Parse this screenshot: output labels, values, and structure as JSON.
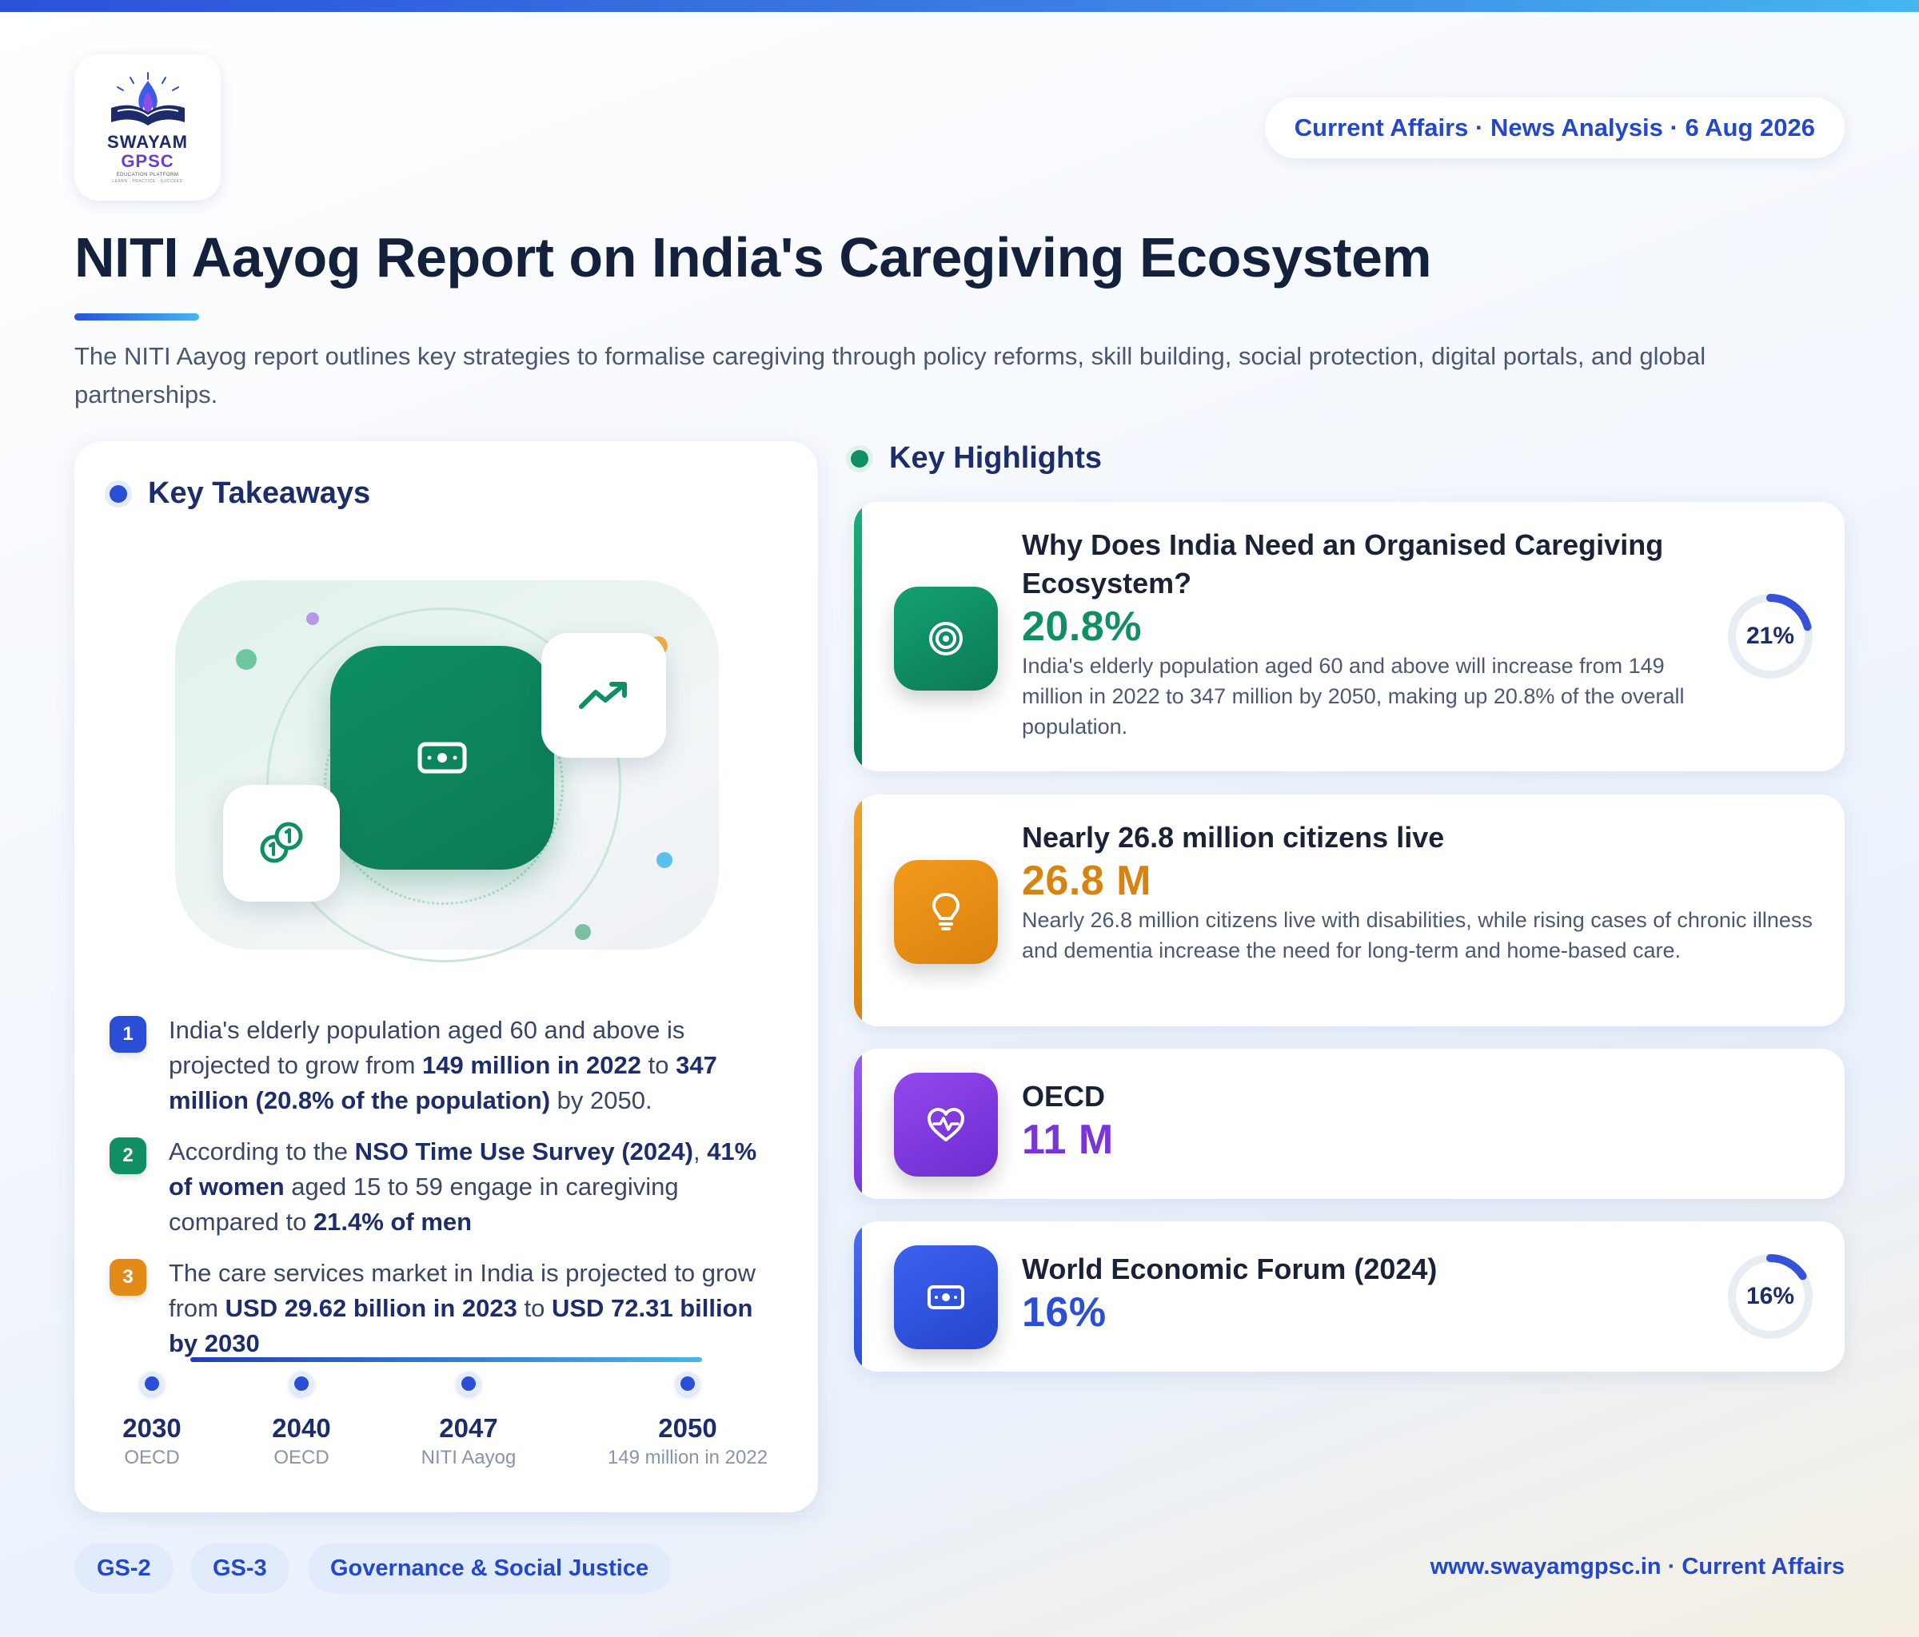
{
  "brand": {
    "word1": "SWAYAM",
    "word2": "GPSC",
    "sub": "EDUCATION PLATFORM",
    "tagline": "LEARN · PRACTICE · SUCCEED"
  },
  "header": {
    "date_pill": "Current Affairs · News Analysis · 6 Aug 2026",
    "title": "NITI Aayog Report on India's Caregiving Ecosystem",
    "intro": "The NITI Aayog report outlines key strategies to formalise caregiving through policy reforms, skill building, social protection, digital portals, and global partnerships."
  },
  "takeaways": {
    "heading": "Key Takeaways",
    "items": [
      {
        "num": "1",
        "p1": "India's elderly population aged 60 and above is projected to grow from ",
        "b1": "149 million in 2022",
        "p2": " to ",
        "b2": "347 million (20.8% of the population)",
        "p3": " by 2050."
      },
      {
        "num": "2",
        "p1": "According to the ",
        "b1": "NSO Time Use Survey (2024)",
        "p2": ", ",
        "b2": "41% of women",
        "p3": " aged 15 to 59 engage in caregiving compared to ",
        "b3": "21.4% of men"
      },
      {
        "num": "3",
        "p1": "The care services market in India is projected to grow from ",
        "b1": "USD 29.62 billion in 2023",
        "p2": " to ",
        "b2": "USD 72.31 billion by 2030"
      }
    ],
    "timeline": [
      {
        "year": "2030",
        "label": "OECD"
      },
      {
        "year": "2040",
        "label": "OECD"
      },
      {
        "year": "2047",
        "label": "NITI Aayog"
      },
      {
        "year": "2050",
        "label": "149 million in 2022"
      }
    ]
  },
  "highlights": {
    "heading": "Key Highlights",
    "cards": [
      {
        "title": "Why Does India Need an Organised Caregiving Ecosystem?",
        "value": "20.8%",
        "desc": "India's elderly population aged 60 and above will increase from 149 million in 2022 to 347 million by 2050, making up 20.8% of the overall population.",
        "gauge": "21%",
        "gauge_fraction": 0.21,
        "color": "#0f8f63",
        "icon": "target-icon"
      },
      {
        "title": "Nearly 26.8 million citizens live",
        "value": "26.8 M",
        "desc": "Nearly 26.8 million citizens live with disabilities, while rising cases of chronic illness and dementia increase the need for long-term and home-based care.",
        "color": "#d9820f",
        "icon": "lightbulb-icon"
      },
      {
        "title": "OECD",
        "value": "11 M",
        "color": "#7a35d9",
        "icon": "heart-pulse-icon"
      },
      {
        "title": "World Economic Forum (2024)",
        "value": "16%",
        "gauge": "16%",
        "gauge_fraction": 0.16,
        "color": "#2a4fd6",
        "icon": "money-icon"
      }
    ]
  },
  "footer": {
    "tags": [
      "GS-2",
      "GS-3",
      "Governance & Social Justice"
    ],
    "site": "www.swayamgpsc.in · Current Affairs"
  },
  "colors": {
    "brand_blue": "#2348c9",
    "navy": "#1d2d6b",
    "green": "#0f8f63",
    "orange": "#d9820f",
    "purple": "#7a35d9",
    "blue": "#2a4fd6"
  }
}
